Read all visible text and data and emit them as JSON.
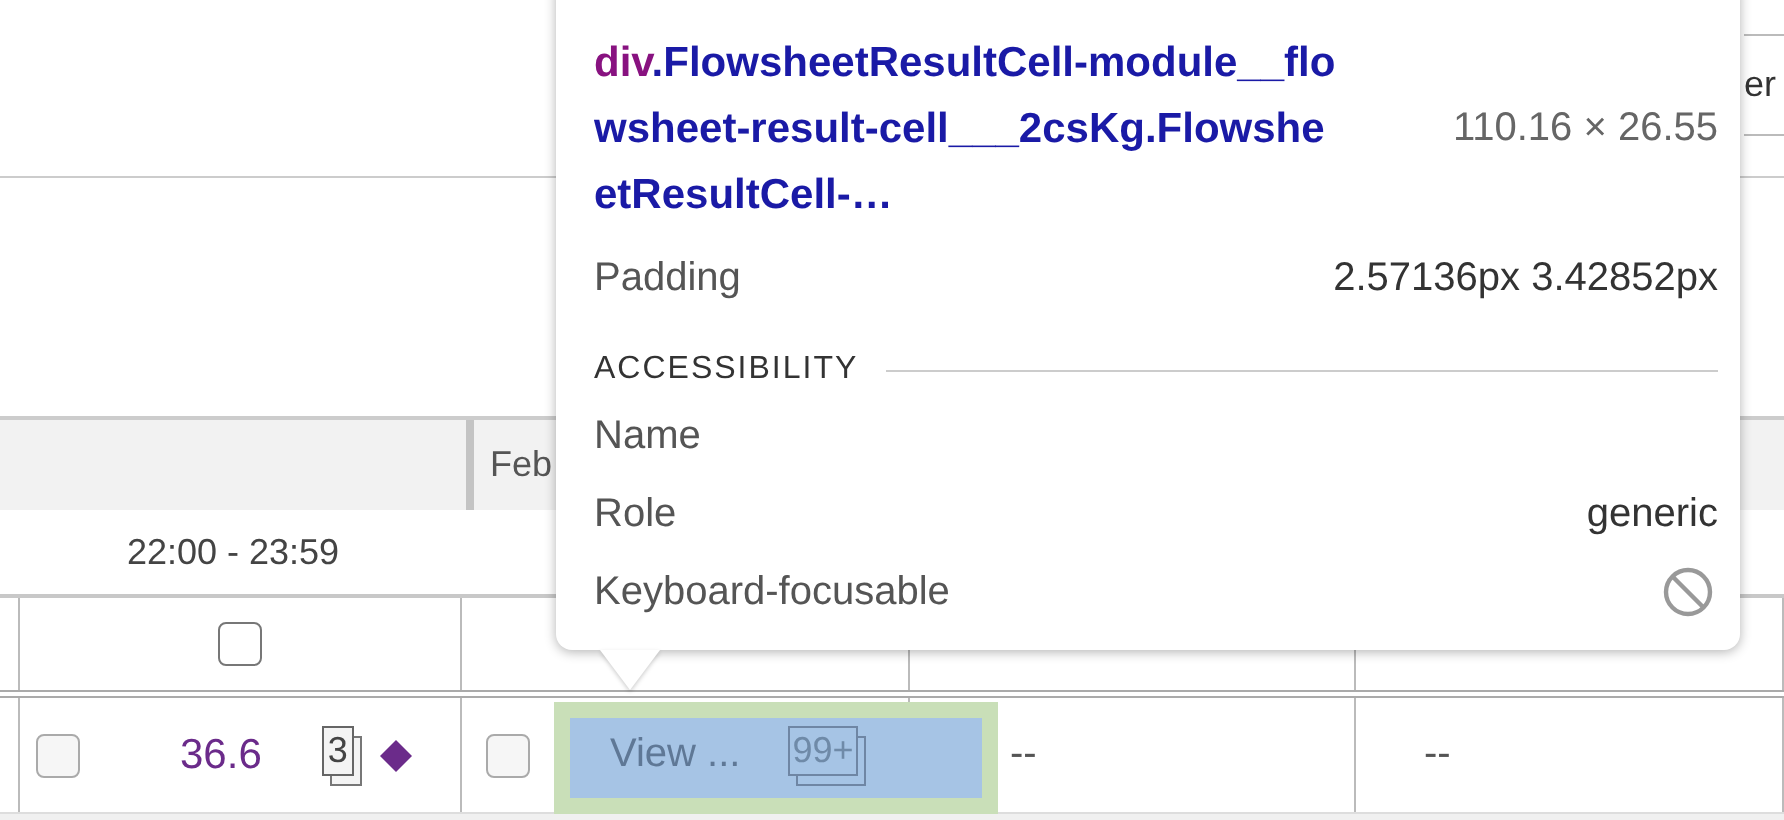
{
  "page": {
    "header_fragment": "er",
    "group_header": "Feb",
    "time_range": "22:00 - 23:59",
    "header_checkboxes": [
      {
        "checked": false
      }
    ],
    "row": {
      "checkbox_1": {
        "checked": false
      },
      "value": "36.6",
      "value_count": "3",
      "checkbox_2": {
        "checked": false
      },
      "link": "View ...",
      "link_count": "99+",
      "cell_4": "--",
      "cell_5": "--"
    }
  },
  "tooltip": {
    "tag": "div",
    "selector": ".FlowsheetResultCell-module__flowsheet-result-cell___2csKg.FlowsheetResultCell-…",
    "size": "110.16 × 26.55",
    "properties": [
      {
        "label": "Padding",
        "value": "2.57136px 3.42852px"
      }
    ],
    "section": "ACCESSIBILITY",
    "accessibility": [
      {
        "label": "Name",
        "kind": "text"
      },
      {
        "label": "Role",
        "kind": "text",
        "value": "generic"
      },
      {
        "label": "Keyboard-focusable",
        "kind": "flag",
        "on": false
      }
    ]
  }
}
